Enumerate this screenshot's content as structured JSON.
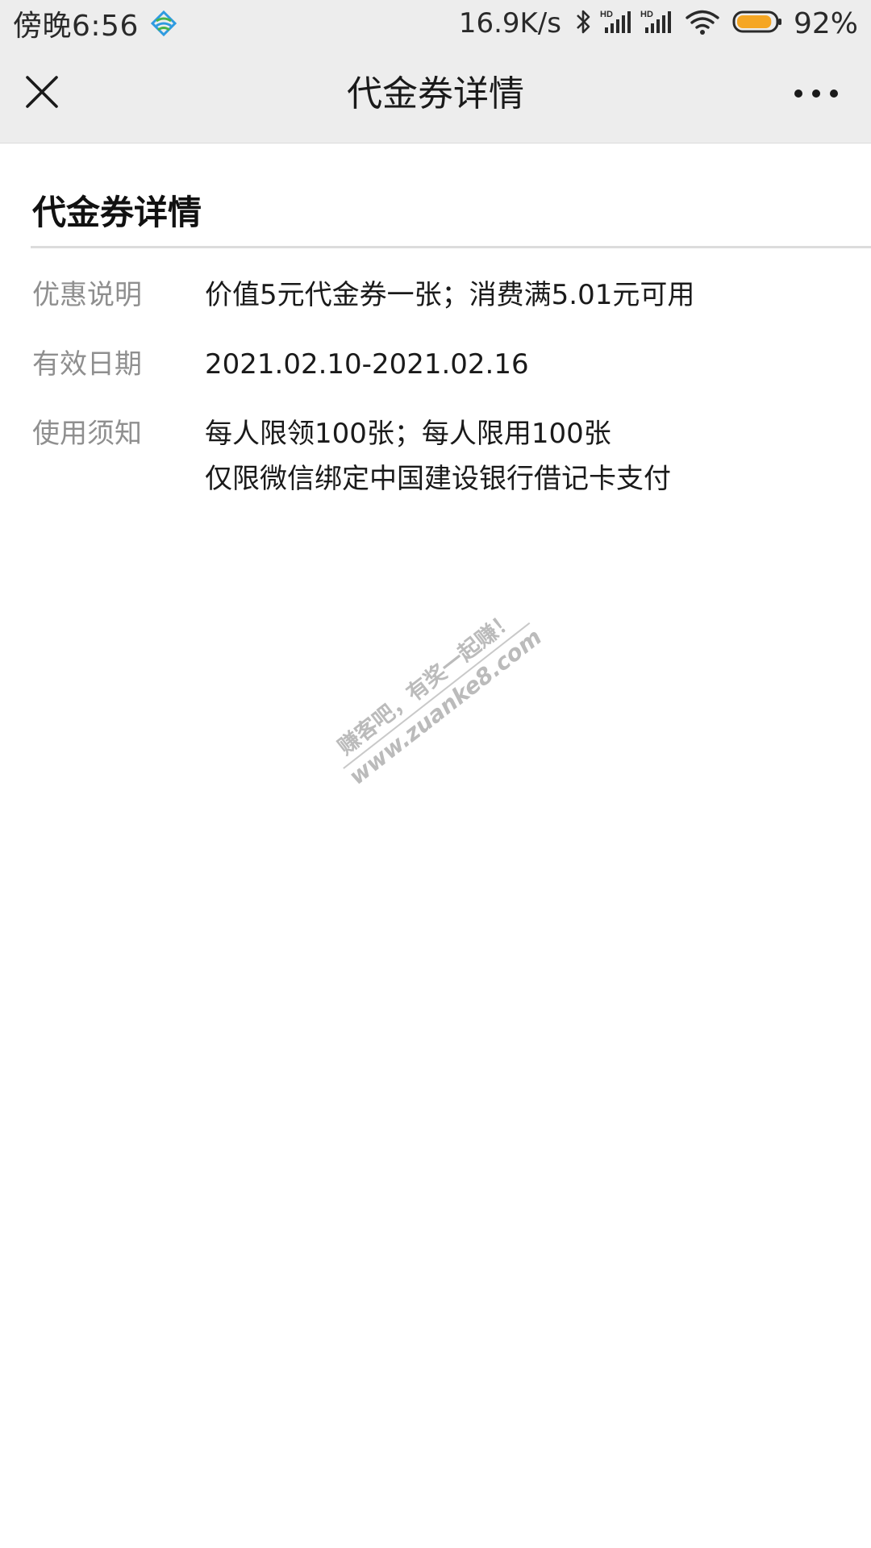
{
  "status_bar": {
    "time": "傍晚6:56",
    "network_speed": "16.9K/s",
    "battery_percent": "92%",
    "battery_level": 0.92,
    "icons": [
      "carrier-icon",
      "bluetooth-icon",
      "hd-signal-icon",
      "hd-signal-icon",
      "wifi-icon",
      "battery-icon"
    ]
  },
  "nav": {
    "title": "代金券详情",
    "close_icon": "close-icon",
    "more_icon": "more-icon"
  },
  "section": {
    "heading": "代金券详情"
  },
  "details": {
    "discount": {
      "label": "优惠说明",
      "value": "价值5元代金券一张；消费满5.01元可用"
    },
    "validity": {
      "label": "有效日期",
      "value": "2021.02.10-2021.02.16"
    },
    "usage": {
      "label": "使用须知",
      "line1": "每人限领100张；每人限用100张",
      "line2": "仅限微信绑定中国建设银行借记卡支付"
    }
  },
  "watermark": {
    "line1": "赚客吧，有奖一起赚！",
    "line2": "www.zuanke8.com"
  },
  "colors": {
    "header_bg": "#ededed",
    "label_text": "#8f8f8f",
    "value_text": "#1a1a1a",
    "battery": "#f5a623"
  }
}
